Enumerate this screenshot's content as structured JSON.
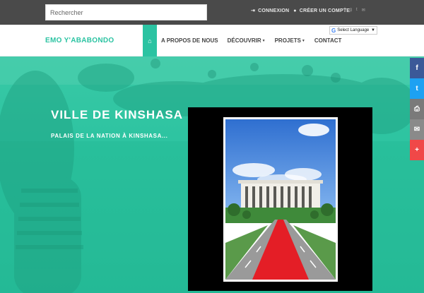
{
  "topbar": {
    "search_placeholder": "Rechercher",
    "login_label": "CONNEXION",
    "register_label": "CRÉER UN COMPTE",
    "social_icons": [
      "facebook-icon",
      "google-plus-icon",
      "twitter-icon",
      "email-icon"
    ]
  },
  "nav": {
    "brand": "EMO Y'ABABONDO",
    "items": [
      {
        "label": "A PROPOS DE NOUS",
        "dropdown": false
      },
      {
        "label": "DÉCOUVRIR",
        "dropdown": true
      },
      {
        "label": "PROJETS",
        "dropdown": true
      },
      {
        "label": "CONTACT",
        "dropdown": false
      }
    ],
    "language_label": "Select Language"
  },
  "hero": {
    "title": "VILLE DE KINSHASA",
    "subtitle": "PALAIS DE LA NATION À KINSHASA..."
  },
  "share": [
    "facebook-icon",
    "twitter-icon",
    "print-icon",
    "email-icon",
    "plus-icon"
  ],
  "colors": {
    "accent": "#2bc3a2",
    "topbar": "#4a4a4a",
    "facebook": "#3b5998",
    "twitter": "#1da1f2",
    "plus": "#f04848"
  }
}
